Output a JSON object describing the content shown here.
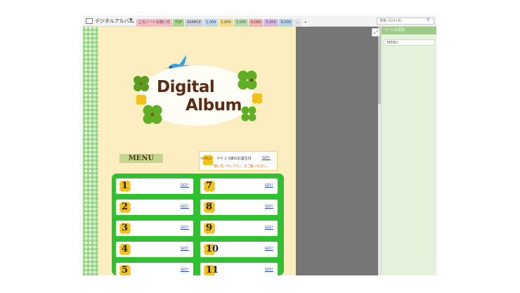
{
  "notebook": {
    "title": "デジタルアルバム"
  },
  "tabs": [
    {
      "label": "このノートの使い方",
      "color": "#f7b9c4"
    },
    {
      "label": "TOP",
      "color": "#a9d98f"
    },
    {
      "label": "SAMPLE",
      "color": "#cfd3dc"
    },
    {
      "label": "1,000",
      "color": "#bcd8f2"
    },
    {
      "label": "2,000",
      "color": "#f6df86"
    },
    {
      "label": "3,000",
      "color": "#b9e0a8"
    },
    {
      "label": "4,000",
      "color": "#f5b3b3"
    },
    {
      "label": "5,000",
      "color": "#d9b8ea"
    },
    {
      "label": "6,000",
      "color": "#b6d3f0"
    },
    {
      "label": "...",
      "color": "#e3e3e3"
    },
    {
      "label": "+",
      "color": "#f3f3f3"
    }
  ],
  "search": {
    "placeholder": "検索 (Ctrl+E)"
  },
  "panel": {
    "add_page": "ページの追加",
    "page_entry": "MENU"
  },
  "header": {
    "title_line1": "Digital",
    "title_line2": "Album"
  },
  "menu": {
    "heading": "MENU"
  },
  "sample": {
    "label": "SAMPLE",
    "title": "マイコ 3歳のお誕生日",
    "go": "GO!!",
    "note": "「使い方（サンプル）」をご覧ください。"
  },
  "menu_items": [
    {
      "num": "1",
      "go": "GO!!"
    },
    {
      "num": "7",
      "go": "GO!!"
    },
    {
      "num": "2",
      "go": "GO!!"
    },
    {
      "num": "8",
      "go": "GO!!"
    },
    {
      "num": "3",
      "go": "GO!!"
    },
    {
      "num": "9",
      "go": "GO!!"
    },
    {
      "num": "4",
      "go": "GO!!"
    },
    {
      "num": "10",
      "go": "GO!!"
    },
    {
      "num": "5",
      "go": "GO!!"
    },
    {
      "num": "11",
      "go": "GO!!"
    }
  ],
  "colors": {
    "grid_green": "#2fc12f",
    "page_bg": "#fdeec2",
    "title_brown": "#5b2c14",
    "panel_green": "#e4f2dc"
  }
}
